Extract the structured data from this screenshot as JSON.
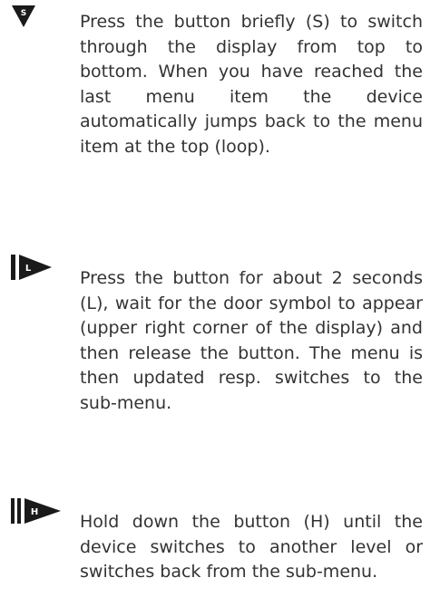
{
  "instructions": [
    {
      "icon": "short-press-icon",
      "icon_letter": "S",
      "text": "Press the button briefly (S) to switch through the display from top to bottom. When you have reached the last menu item the device automatically jumps back to the menu item at the top (loop)."
    },
    {
      "icon": "long-press-icon",
      "icon_letter": "L",
      "text": "Press the button for about 2 seconds (L), wait for the door symbol to appear (upper right corner of the display) and then release the button. The menu is then updated resp. switches to the sub-menu."
    },
    {
      "icon": "hold-press-icon",
      "icon_letter": "H",
      "text": "Hold down the button (H) until the device switches to another level or switches back from the sub-menu."
    }
  ],
  "colors": {
    "icon": "#1a1a1a",
    "text": "#333333"
  }
}
